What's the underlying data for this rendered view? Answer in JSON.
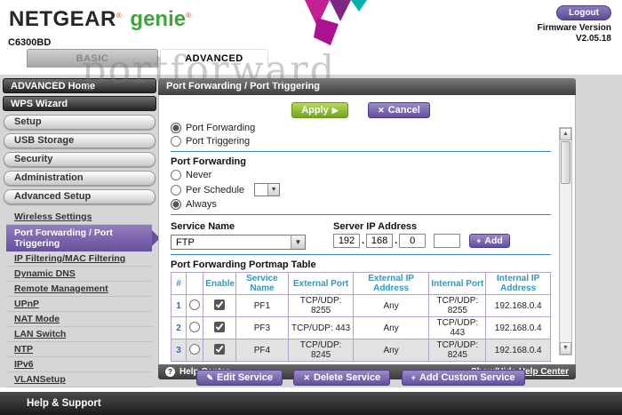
{
  "header": {
    "brand": "NETGEAR",
    "brand_sub": "genie",
    "reg_mark": "®",
    "model": "C6300BD",
    "logout_label": "Logout",
    "firmware_label": "Firmware Version",
    "firmware_version": "V2.05.18"
  },
  "tabs": [
    {
      "label": "BASIC"
    },
    {
      "label": "ADVANCED"
    }
  ],
  "watermark": "portforward",
  "sidebar": {
    "dark_items": [
      "ADVANCED Home",
      "WPS Wizard"
    ],
    "buttons": [
      "Setup",
      "USB Storage",
      "Security",
      "Administration",
      "Advanced Setup"
    ],
    "links": [
      "Wireless Settings",
      "Port Forwarding / Port Triggering",
      "IP Filtering/MAC Filtering",
      "Dynamic DNS",
      "Remote Management",
      "UPnP",
      "NAT Mode",
      "LAN Switch",
      "NTP",
      "IPv6",
      "VLANSetup"
    ],
    "selected_link": "Port Forwarding / Port Triggering"
  },
  "content": {
    "title": "Port Forwarding / Port Triggering",
    "apply_label": "Apply",
    "cancel_label": "Cancel",
    "mode": {
      "options": [
        "Port Forwarding",
        "Port Triggering"
      ],
      "selected": "Port Forwarding"
    },
    "pf_section_label": "Port Forwarding",
    "schedule": {
      "options": [
        "Never",
        "Per Schedule",
        "Always"
      ],
      "selected": "Always"
    },
    "service_name_label": "Service Name",
    "service_name_value": "FTP",
    "server_ip_label": "Server IP Address",
    "server_ip_octets": [
      "192",
      "168",
      "0",
      ""
    ],
    "add_label": "Add",
    "table_title": "Port Forwarding Portmap Table",
    "table": {
      "headers": [
        "#",
        "",
        "Enable",
        "Service Name",
        "External Port",
        "External IP Address",
        "Internal Port",
        "Internal IP Address"
      ],
      "rows": [
        {
          "num": "1",
          "enabled": true,
          "service": "PF1",
          "ext_port": "TCP/UDP: 8255",
          "ext_ip": "Any",
          "int_port": "TCP/UDP: 8255",
          "int_ip": "192.168.0.4"
        },
        {
          "num": "2",
          "enabled": true,
          "service": "PF3",
          "ext_port": "TCP/UDP: 443",
          "ext_ip": "Any",
          "int_port": "TCP/UDP: 443",
          "int_ip": "192.168.0.4"
        },
        {
          "num": "3",
          "enabled": true,
          "service": "PF4",
          "ext_port": "TCP/UDP: 8245",
          "ext_ip": "Any",
          "int_port": "TCP/UDP: 8245",
          "int_ip": "192.168.0.4"
        }
      ]
    },
    "edit_service_label": "Edit Service",
    "delete_service_label": "Delete Service",
    "add_custom_label": "Add Custom Service",
    "help_center_label": "Help Center",
    "show_hide_label": "Show/Hide Help Center"
  },
  "footer": {
    "label": "Help & Support"
  },
  "icons": {
    "play": "▶",
    "x": "✕",
    "plus": "+",
    "pencil": "✎",
    "question": "?",
    "dropdown_arrow": "▼",
    "scroll_up": "▲",
    "scroll_down": "▼"
  },
  "colors": {
    "accent_purple": "#63509c",
    "accent_green": "#74a41d",
    "brand_green": "#3fa43c",
    "brand_orange": "#f26822",
    "magenta": "#c51f93",
    "teal": "#00b1b0",
    "table_header_text": "#2b9ac2",
    "rule_blue": "#3a7fb5"
  }
}
